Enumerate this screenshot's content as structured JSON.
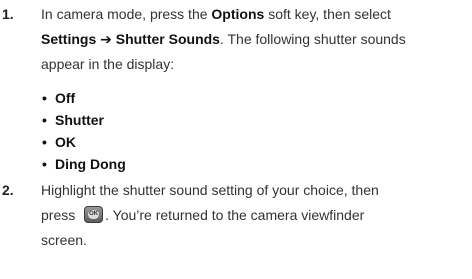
{
  "steps": [
    {
      "number": "1.",
      "text_1": "In camera mode, press the ",
      "bold_1": "Options",
      "text_2": " soft key, then select",
      "bold_2": "Settings ➔ Shutter Sounds",
      "text_3": ". The following shutter sounds",
      "text_4": "appear in the display:"
    },
    {
      "number": "2.",
      "text_1": "Highlight the shutter sound setting of your choice, then",
      "text_2": "press ",
      "text_3": ". You’re returned to the camera viewfinder",
      "text_4": "screen."
    }
  ],
  "bullet_symbol": "•",
  "shutter_sounds": [
    "Off",
    "Shutter",
    "OK",
    "Ding Dong"
  ],
  "ok_key_label": "OK",
  "ok_key_icon": "ok-key-icon"
}
